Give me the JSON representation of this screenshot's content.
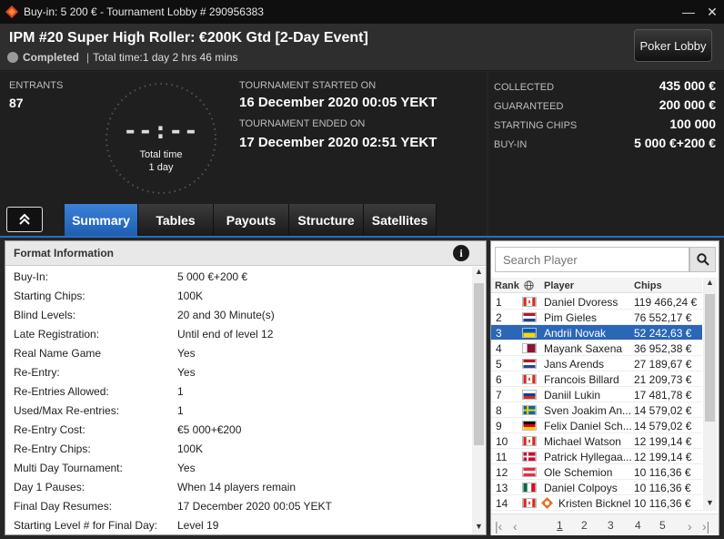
{
  "window": {
    "title": "Buy-in: 5 200 € - Tournament Lobby # 290956383",
    "minimize": "—",
    "close": "✕"
  },
  "tournament": {
    "name": "IPM #20 Super High Roller: €200K Gtd [2-Day Event]",
    "status": "Completed",
    "separator": "|",
    "total_time_line": "Total time:1 day 2 hrs  46 mins",
    "status_color": "#9a9a9a"
  },
  "poker_lobby_button": "Poker Lobby",
  "info": {
    "entrants_label": "ENTRANTS",
    "entrants_value": "87",
    "clock_digits": "--:--",
    "clock_caption1": "Total time",
    "clock_caption2": "1 day",
    "started_label": "TOURNAMENT STARTED ON",
    "started_value": "16 December 2020  00:05 YEKT",
    "ended_label": "TOURNAMENT ENDED ON",
    "ended_value": "17 December 2020  02:51 YEKT"
  },
  "money": [
    {
      "label": "COLLECTED",
      "value": "435 000 €"
    },
    {
      "label": "GUARANTEED",
      "value": "200 000 €"
    },
    {
      "label": "STARTING CHIPS",
      "value": "100 000"
    },
    {
      "label": "BUY-IN",
      "value": "5 000 €+200 €"
    }
  ],
  "tabs": [
    {
      "label": "Summary",
      "active": true
    },
    {
      "label": "Tables",
      "active": false
    },
    {
      "label": "Payouts",
      "active": false
    },
    {
      "label": "Structure",
      "active": false
    },
    {
      "label": "Satellites",
      "active": false
    }
  ],
  "format": {
    "title": "Format Information",
    "info_icon": "i",
    "rows": [
      {
        "k": "Buy-In:",
        "v": "5 000 €+200 €"
      },
      {
        "k": "Starting Chips:",
        "v": "100K"
      },
      {
        "k": "Blind Levels:",
        "v": "20 and 30 Minute(s)"
      },
      {
        "k": "Late Registration:",
        "v": "Until end of level 12"
      },
      {
        "k": "Real Name Game",
        "v": "Yes"
      },
      {
        "k": "Re-Entry:",
        "v": "Yes"
      },
      {
        "k": "Re-Entries Allowed:",
        "v": "1"
      },
      {
        "k": "Used/Max Re-entries:",
        "v": "1"
      },
      {
        "k": "Re-Entry Cost:",
        "v": "€5 000+€200"
      },
      {
        "k": "Re-Entry Chips:",
        "v": "100K"
      },
      {
        "k": "Multi Day Tournament:",
        "v": "Yes"
      },
      {
        "k": "Day 1 Pauses:",
        "v": "When 14 players remain"
      },
      {
        "k": "Final Day Resumes:",
        "v": "17 December 2020  00:05 YEKT"
      },
      {
        "k": "Starting Level # for  Final Day:",
        "v": "Level 19"
      }
    ]
  },
  "players": {
    "search_placeholder": "Search Player",
    "col_rank": "Rank",
    "col_player": "Player",
    "col_chips": "Chips",
    "rows": [
      {
        "rank": "1",
        "name": "Daniel Dvoress",
        "chips": "119 466,24 €",
        "flag": "ca"
      },
      {
        "rank": "2",
        "name": "Pim Gieles",
        "chips": "76 552,17 €",
        "flag": "nl"
      },
      {
        "rank": "3",
        "name": "Andrii Novak",
        "chips": "52 242,63 €",
        "flag": "ua",
        "selected": true
      },
      {
        "rank": "4",
        "name": "Mayank Saxena",
        "chips": "36 952,38 €",
        "flag": "qa"
      },
      {
        "rank": "5",
        "name": "Jans Arends",
        "chips": "27 189,67 €",
        "flag": "nl"
      },
      {
        "rank": "6",
        "name": "Francois Billard",
        "chips": "21 209,73 €",
        "flag": "ca"
      },
      {
        "rank": "7",
        "name": "Daniil Lukin",
        "chips": "17 481,78 €",
        "flag": "ru"
      },
      {
        "rank": "8",
        "name": "Sven Joakim An...",
        "chips": "14 579,02 €",
        "flag": "se"
      },
      {
        "rank": "9",
        "name": "Felix Daniel Sch...",
        "chips": "14 579,02 €",
        "flag": "de"
      },
      {
        "rank": "10",
        "name": "Michael Watson",
        "chips": "12 199,14 €",
        "flag": "ca"
      },
      {
        "rank": "11",
        "name": "Patrick Hyllegaa...",
        "chips": "12 199,14 €",
        "flag": "dk"
      },
      {
        "rank": "12",
        "name": "Ole Schemion",
        "chips": "10 116,36 €",
        "flag": "at"
      },
      {
        "rank": "13",
        "name": "Daniel Colpoys",
        "chips": "10 116,36 €",
        "flag": "mx"
      },
      {
        "rank": "14",
        "name": "Kristen Bicknel",
        "chips": "10 116,36 €",
        "flag": "ca",
        "badge": true
      }
    ],
    "pages": [
      "1",
      "2",
      "3",
      "4",
      "5"
    ],
    "current_page": "1"
  },
  "colors": {
    "accent_blue": "#2b66b7",
    "tab_active": "#2f74c9",
    "brand_red": "#e0412a"
  }
}
